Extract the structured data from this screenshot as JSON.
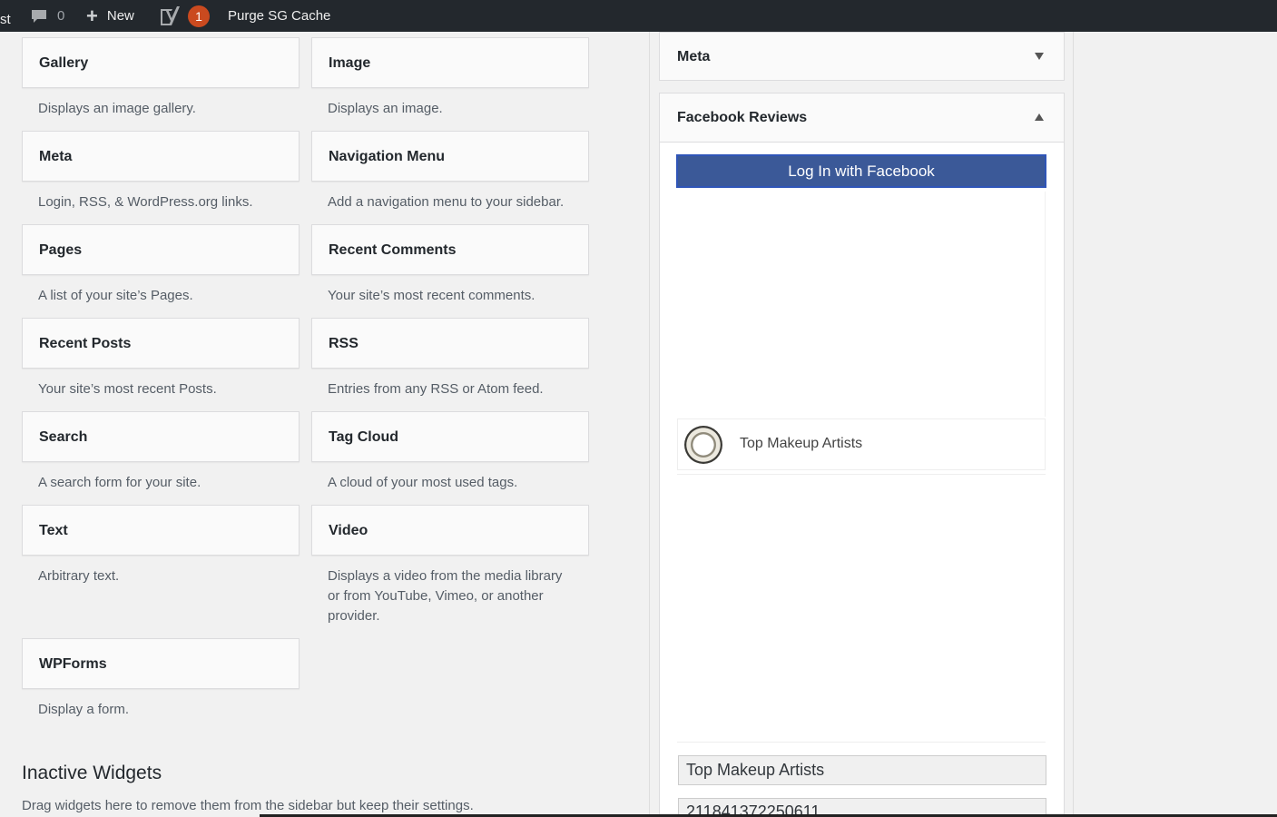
{
  "adminbar": {
    "cut_label": "st",
    "comments_count": "0",
    "new_label": "New",
    "yoast_badge": "1",
    "purge_label": "Purge SG Cache"
  },
  "widgets": [
    {
      "title": "Gallery",
      "desc": "Displays an image gallery."
    },
    {
      "title": "Image",
      "desc": "Displays an image."
    },
    {
      "title": "Meta",
      "desc": "Login, RSS, & WordPress.org links."
    },
    {
      "title": "Navigation Menu",
      "desc": "Add a navigation menu to your sidebar."
    },
    {
      "title": "Pages",
      "desc": "A list of your site’s Pages."
    },
    {
      "title": "Recent Comments",
      "desc": "Your site’s most recent comments."
    },
    {
      "title": "Recent Posts",
      "desc": "Your site’s most recent Posts."
    },
    {
      "title": "RSS",
      "desc": "Entries from any RSS or Atom feed."
    },
    {
      "title": "Search",
      "desc": "A search form for your site."
    },
    {
      "title": "Tag Cloud",
      "desc": "A cloud of your most used tags."
    },
    {
      "title": "Text",
      "desc": "Arbitrary text."
    },
    {
      "title": "Video",
      "desc": "Displays a video from the media library or from YouTube, Vimeo, or another provider."
    },
    {
      "title": "WPForms",
      "desc": "Display a form."
    }
  ],
  "inactive": {
    "heading": "Inactive Widgets",
    "desc": "Drag widgets here to remove them from the sidebar but keep their settings."
  },
  "sidebar": {
    "meta_title": "Meta",
    "fb_title": "Facebook Reviews",
    "fb_login_label": "Log In with Facebook",
    "page_name": "Top Makeup Artists",
    "title_field_value": "Top Makeup Artists",
    "id_field_value": "211841372250611"
  }
}
